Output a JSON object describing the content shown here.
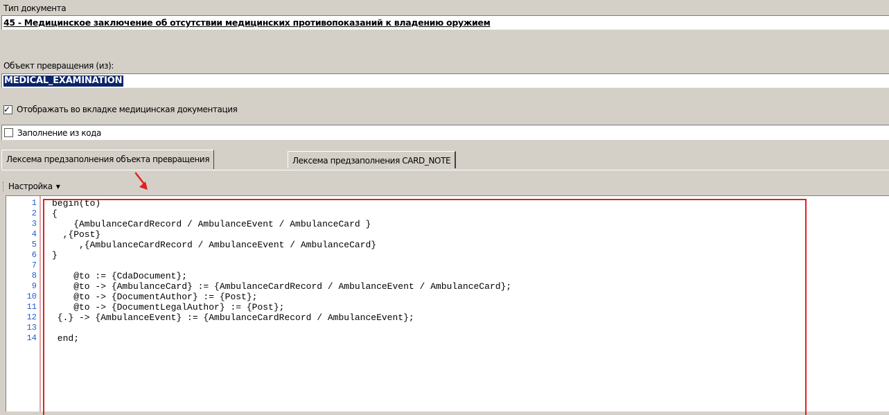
{
  "document_type": {
    "label": "Тип документа",
    "value": "45 - Медицинское заключение об отсутствии медицинских противопоказаний к владению оружием"
  },
  "transform_object": {
    "label": "Объект превращения (из):",
    "value": "MEDICAL_EXAMINATION"
  },
  "checkboxes": {
    "show_in_medical_docs": {
      "label": "Отображать во вкладке медицинская документация",
      "checked": true
    },
    "fill_from_code": {
      "label": "Заполнение из кода",
      "checked": false
    }
  },
  "tabs": [
    {
      "label": "Лексема предзаполнения объекта превращения",
      "active": true
    },
    {
      "label": "Лексема предзаполнения CARD_NOTE",
      "active": false
    }
  ],
  "toolbar": {
    "settings_label": "Настройка"
  },
  "colors": {
    "annotation": "#e02020",
    "selection": "#0a246a",
    "line_numbers": "#1e5fcf"
  },
  "editor": {
    "lines": [
      "begin(to)",
      "{",
      "    {AmbulanceCardRecord / AmbulanceEvent / AmbulanceCard }",
      "  ,{Post}",
      "     ,{AmbulanceCardRecord / AmbulanceEvent / AmbulanceCard}",
      "}",
      "",
      "    @to := {CdaDocument};",
      "    @to -> {AmbulanceCard} := {AmbulanceCardRecord / AmbulanceEvent / AmbulanceCard};",
      "    @to -> {DocumentAuthor} := {Post};",
      "    @to -> {DocumentLegalAuthor} := {Post};",
      " {.} -> {AmbulanceEvent} := {AmbulanceCardRecord / AmbulanceEvent};",
      "",
      " end;"
    ]
  }
}
